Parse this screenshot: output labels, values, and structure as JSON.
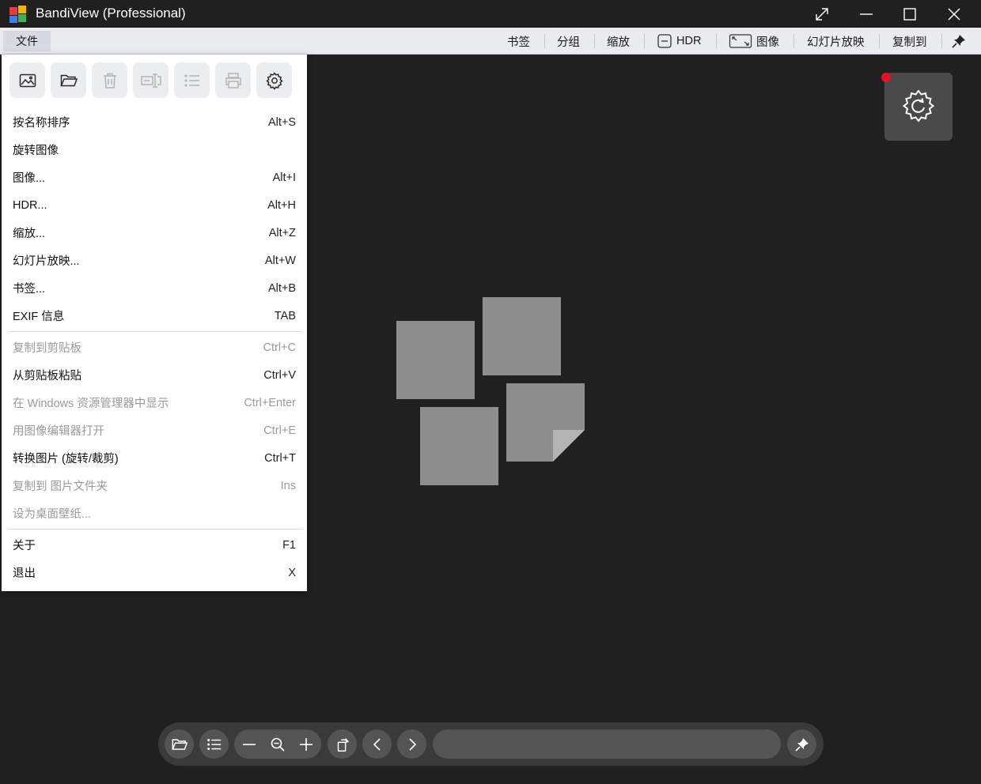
{
  "window": {
    "title": "BandiView (Professional)"
  },
  "menubar": {
    "file_label": "文件",
    "items": {
      "bookmark": "书签",
      "group": "分组",
      "zoom": "缩放",
      "hdr": "HDR",
      "image": "图像",
      "slideshow": "幻灯片放映",
      "copy_to": "复制到"
    }
  },
  "dropdown": {
    "icons": [
      {
        "name": "open-image-icon",
        "enabled": true
      },
      {
        "name": "open-folder-icon",
        "enabled": true
      },
      {
        "name": "delete-icon",
        "enabled": false
      },
      {
        "name": "rename-icon",
        "enabled": false
      },
      {
        "name": "list-icon",
        "enabled": false
      },
      {
        "name": "print-icon",
        "enabled": false
      },
      {
        "name": "settings-icon",
        "enabled": true
      }
    ],
    "items": [
      {
        "label": "按名称排序",
        "shortcut": "Alt+S",
        "enabled": true
      },
      {
        "label": "旋转图像",
        "shortcut": "",
        "enabled": true
      },
      {
        "label": "图像...",
        "shortcut": "Alt+I",
        "enabled": true
      },
      {
        "label": "HDR...",
        "shortcut": "Alt+H",
        "enabled": true
      },
      {
        "label": "缩放...",
        "shortcut": "Alt+Z",
        "enabled": true
      },
      {
        "label": "幻灯片放映...",
        "shortcut": "Alt+W",
        "enabled": true
      },
      {
        "label": "书签...",
        "shortcut": "Alt+B",
        "enabled": true
      },
      {
        "label": "EXIF 信息",
        "shortcut": "TAB",
        "enabled": true
      },
      {
        "label": "复制到剪贴板",
        "shortcut": "Ctrl+C",
        "enabled": false
      },
      {
        "label": "从剪贴板粘贴",
        "shortcut": "Ctrl+V",
        "enabled": true
      },
      {
        "label": "在 Windows 资源管理器中显示",
        "shortcut": "Ctrl+Enter",
        "enabled": false
      },
      {
        "label": "用图像编辑器打开",
        "shortcut": "Ctrl+E",
        "enabled": false
      },
      {
        "label": "转换图片 (旋转/裁剪)",
        "shortcut": "Ctrl+T",
        "enabled": true
      },
      {
        "label": "复制到 图片文件夹",
        "shortcut": "Ins",
        "enabled": false
      },
      {
        "label": "设为桌面壁纸...",
        "shortcut": "",
        "enabled": false
      },
      {
        "label": "关于",
        "shortcut": "F1",
        "enabled": true
      },
      {
        "label": "退出",
        "shortcut": "X",
        "enabled": true
      }
    ]
  },
  "colors": {
    "background": "#202020",
    "menubar": "#e9ebef",
    "notification_dot": "#e81123",
    "placeholder_tile": "#8e8e8e"
  }
}
